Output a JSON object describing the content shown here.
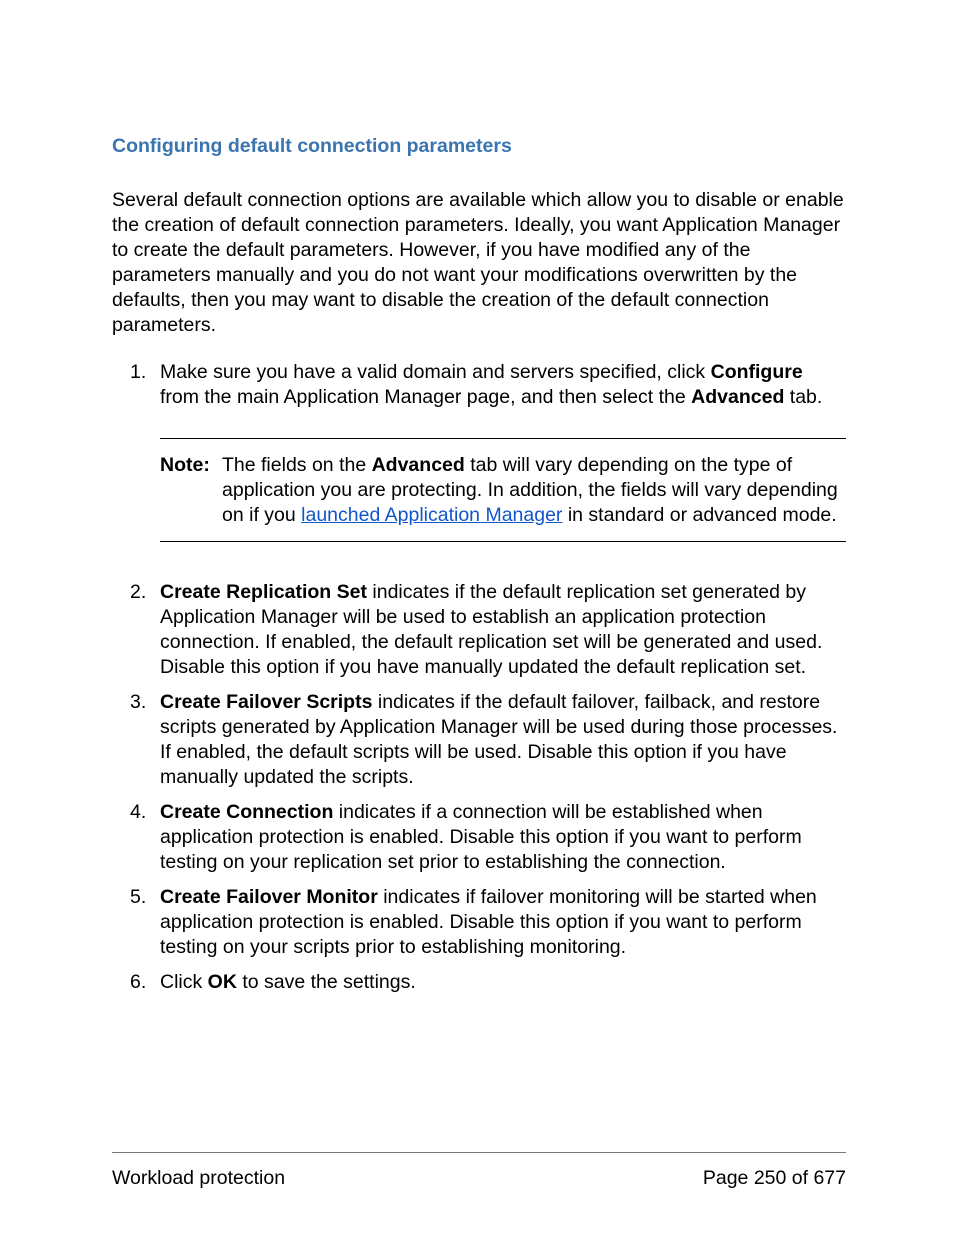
{
  "heading": "Configuring default connection parameters",
  "intro": "Several default connection options are available which allow you to disable or enable the creation of default connection parameters. Ideally, you want Application Manager to create the default parameters. However, if you have modified any of the parameters manually and you do not want your modifications overwritten by the defaults, then you may want to disable the creation of the default connection parameters.",
  "items": {
    "i1": {
      "pre": "Make sure you have a valid domain and servers specified, click ",
      "b1": "Configure",
      "mid": " from the main Application Manager page, and then select the ",
      "b2": "Advanced",
      "post": " tab."
    },
    "note": {
      "label": "Note:",
      "pre": "The fields on the ",
      "b1": "Advanced",
      "mid": " tab will vary depending on the type of application you are protecting. In addition, the fields will vary depending on if you ",
      "link": "launched Application Manager",
      "post": " in standard or advanced mode."
    },
    "i2": {
      "b1": "Create Replication Set",
      "post": " indicates if the default replication set generated by Application Manager will be used to establish an application protection connection. If enabled, the default replication set will be generated and used. Disable this option if you have manually updated the default replication set."
    },
    "i3": {
      "b1": "Create Failover Scripts",
      "post": " indicates if the default failover, failback, and restore scripts generated by Application Manager will be used during those processes. If enabled, the default scripts will be used. Disable this option if you have manually updated the scripts."
    },
    "i4": {
      "b1": "Create Connection",
      "post": " indicates if a connection will be established when application protection is enabled. Disable this option if you want to perform testing on your replication set prior to establishing the connection."
    },
    "i5": {
      "b1": "Create Failover Monitor",
      "post": " indicates if failover monitoring will be started when application protection is enabled. Disable this option if you want to perform testing on your scripts prior to establishing monitoring."
    },
    "i6": {
      "pre": "Click ",
      "b1": "OK",
      "post": " to save the settings."
    }
  },
  "footer": {
    "left": "Workload protection",
    "right": "Page 250 of 677"
  }
}
